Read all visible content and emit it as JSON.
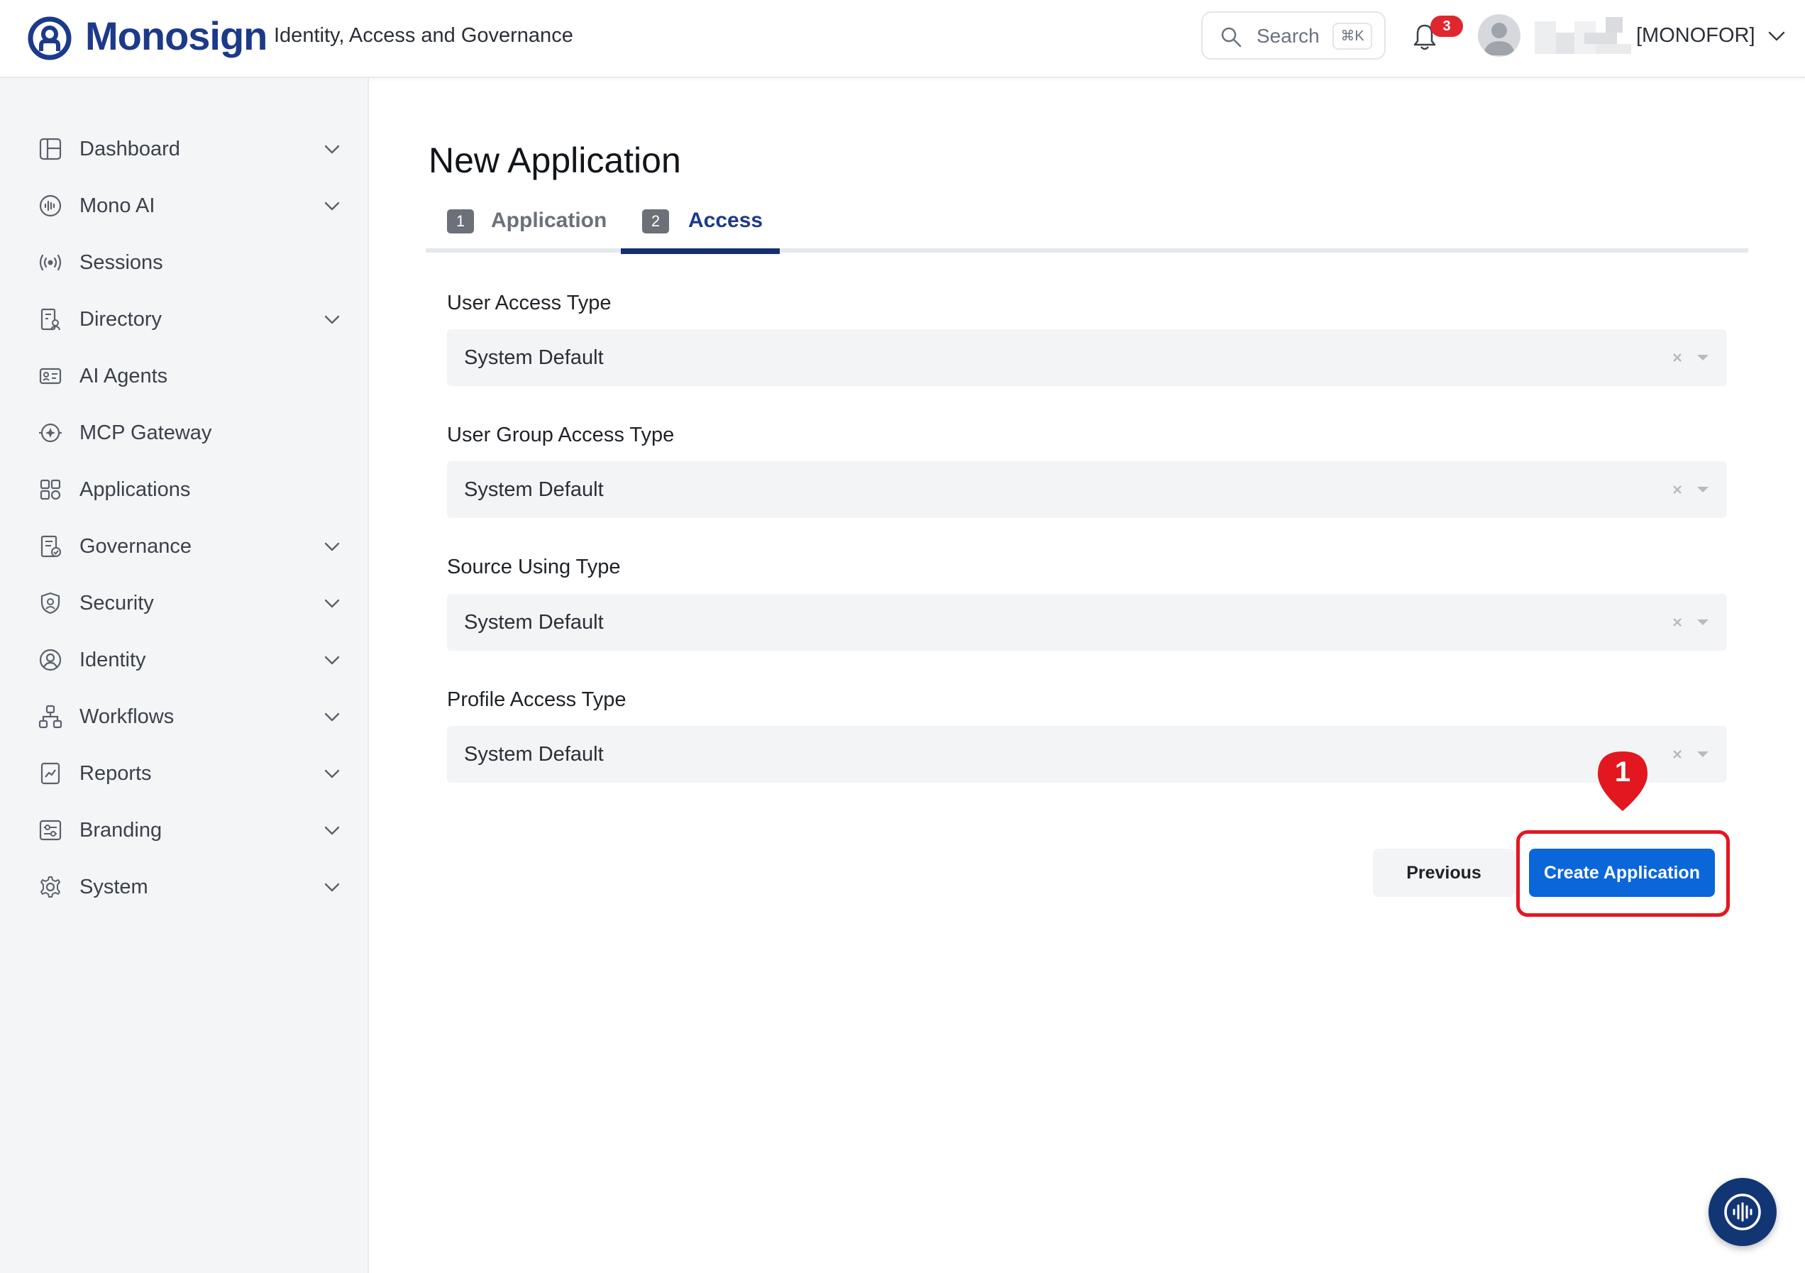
{
  "brand": {
    "name": "Monosign",
    "tagline": "Identity, Access and Governance",
    "color": "#1d3a8a"
  },
  "header": {
    "search_label": "Search",
    "search_shortcut": "⌘K",
    "notification_count": "3",
    "user_org": "[MONOFOR]"
  },
  "sidebar": {
    "items": [
      {
        "label": "Dashboard",
        "icon": "dashboard-icon",
        "expandable": true
      },
      {
        "label": "Mono AI",
        "icon": "ai-waveform-icon",
        "expandable": true
      },
      {
        "label": "Sessions",
        "icon": "broadcast-icon",
        "expandable": false
      },
      {
        "label": "Directory",
        "icon": "directory-icon",
        "expandable": true
      },
      {
        "label": "AI Agents",
        "icon": "agent-card-icon",
        "expandable": false
      },
      {
        "label": "MCP Gateway",
        "icon": "gateway-icon",
        "expandable": false
      },
      {
        "label": "Applications",
        "icon": "apps-grid-icon",
        "expandable": false
      },
      {
        "label": "Governance",
        "icon": "governance-icon",
        "expandable": true
      },
      {
        "label": "Security",
        "icon": "shield-icon",
        "expandable": true
      },
      {
        "label": "Identity",
        "icon": "user-circle-icon",
        "expandable": true
      },
      {
        "label": "Workflows",
        "icon": "workflow-icon",
        "expandable": true
      },
      {
        "label": "Reports",
        "icon": "report-icon",
        "expandable": true
      },
      {
        "label": "Branding",
        "icon": "sliders-icon",
        "expandable": true
      },
      {
        "label": "System",
        "icon": "gear-icon",
        "expandable": true
      }
    ]
  },
  "main": {
    "title": "New Application",
    "tabs": [
      {
        "num": "1",
        "label": "Application",
        "active": false
      },
      {
        "num": "2",
        "label": "Access",
        "active": true
      }
    ],
    "fields": [
      {
        "label": "User Access Type",
        "value": "System Default"
      },
      {
        "label": "User Group Access Type",
        "value": "System Default"
      },
      {
        "label": "Source Using Type",
        "value": "System Default"
      },
      {
        "label": "Profile Access Type",
        "value": "System Default"
      }
    ],
    "previous_label": "Previous",
    "create_label": "Create Application"
  },
  "annotation": {
    "step": "1",
    "color": "#e3171f"
  },
  "colors": {
    "primary_button": "#0a66d9",
    "active_tab": "#16306e",
    "badge": "#e0262f"
  }
}
